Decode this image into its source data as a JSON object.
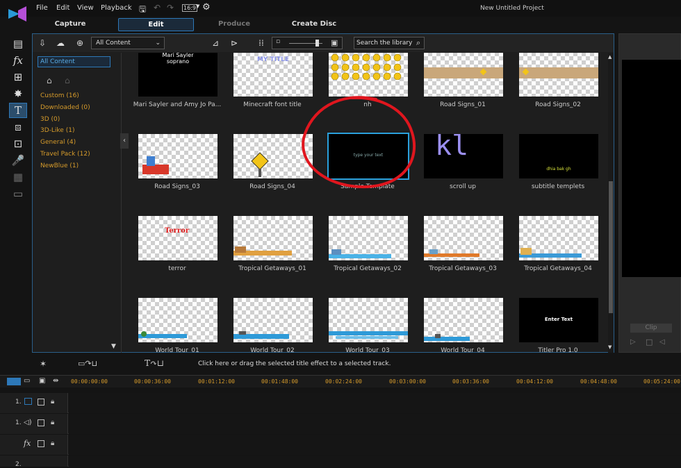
{
  "menu": {
    "items": [
      "File",
      "Edit",
      "View",
      "Playback"
    ],
    "aspect": "16:9"
  },
  "project_title": "New Untitled Project",
  "modes": {
    "capture": "Capture",
    "edit": "Edit",
    "produce": "Produce",
    "create_disc": "Create Disc"
  },
  "library": {
    "filter_value": "All Content",
    "search_placeholder": "Search the library",
    "selected_category": "All Content",
    "categories": [
      {
        "label": "Custom  (16)"
      },
      {
        "label": "Downloaded  (0)"
      },
      {
        "label": "3D  (0)"
      },
      {
        "label": "3D-Like  (1)"
      },
      {
        "label": "General  (4)"
      },
      {
        "label": "Travel Pack  (12)"
      },
      {
        "label": "NewBlue  (1)"
      }
    ],
    "tiles": [
      {
        "label": "Mari Sayler and Amy Jo Pa...",
        "text": "Mari Sayler\nsoprano",
        "bg": "black"
      },
      {
        "label": "Minecraft font  title",
        "text": "MY TITLE",
        "bg": "checker"
      },
      {
        "label": "nh",
        "text": "",
        "bg": "checker"
      },
      {
        "label": "Road Signs_01",
        "text": "",
        "bg": "checker"
      },
      {
        "label": "Road Signs_02",
        "text": "",
        "bg": "checker"
      },
      {
        "label": "Road Signs_03",
        "text": "",
        "bg": "checker"
      },
      {
        "label": "Road Signs_04",
        "text": "",
        "bg": "checker"
      },
      {
        "label": "Sample Template",
        "text": "type your text",
        "bg": "black"
      },
      {
        "label": "scroll up",
        "text": "kl",
        "bg": "black"
      },
      {
        "label": "subtitle templets",
        "text": "dhia bak gh",
        "bg": "black"
      },
      {
        "label": "terror",
        "text": "Terror",
        "bg": "checker"
      },
      {
        "label": "Tropical Getaways_01",
        "text": "",
        "bg": "checker"
      },
      {
        "label": "Tropical Getaways_02",
        "text": "",
        "bg": "checker"
      },
      {
        "label": "Tropical Getaways_03",
        "text": "",
        "bg": "checker"
      },
      {
        "label": "Tropical Getaways_04",
        "text": "",
        "bg": "checker"
      },
      {
        "label": "World Tour_01",
        "text": "",
        "bg": "checker"
      },
      {
        "label": "World Tour_02",
        "text": "",
        "bg": "checker"
      },
      {
        "label": "World Tour_03",
        "text": "",
        "bg": "checker"
      },
      {
        "label": "World Tour_04",
        "text": "",
        "bg": "checker"
      },
      {
        "label": "Titler Pro 1.0",
        "text": "Enter Text",
        "bg": "black"
      }
    ]
  },
  "preview": {
    "clip_label": "Clip"
  },
  "timeline": {
    "hint": "Click here or drag the selected title effect to a selected track.",
    "ticks": [
      "00:00:00:00",
      "00:00:36:00",
      "00:01:12:00",
      "00:01:48:00",
      "00:02:24:00",
      "00:03:00:00",
      "00:03:36:00",
      "00:04:12:00",
      "00:04:48:00",
      "00:05:24:00"
    ],
    "tracks": [
      {
        "num": "1."
      },
      {
        "num": "1."
      },
      {
        "num": ""
      },
      {
        "num": "2."
      }
    ]
  },
  "colors": {
    "accent": "#2d78b8",
    "category": "#d69b2b",
    "annotation_circle": "#e0161e"
  }
}
